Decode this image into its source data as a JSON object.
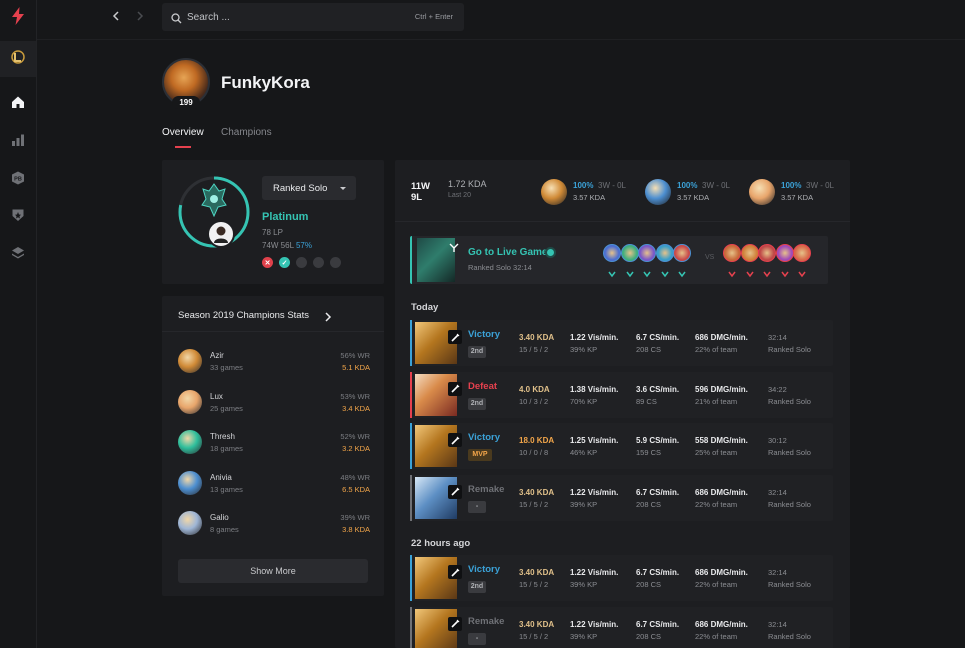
{
  "search": {
    "placeholder": "Search ...",
    "shortcut": "Ctrl + Enter"
  },
  "profile": {
    "name": "FunkyKora",
    "level": "199"
  },
  "tabs": [
    {
      "label": "Overview",
      "active": true
    },
    {
      "label": "Champions",
      "active": false
    }
  ],
  "rank": {
    "queue": "Ranked Solo",
    "tier": "Platinum",
    "lp": "78 LP",
    "record": "74W 56L",
    "winrate": "57%",
    "recent": [
      "loss",
      "win",
      "none",
      "none",
      "none"
    ]
  },
  "season_stats": {
    "title": "Season 2019 Champions Stats",
    "champions": [
      {
        "name": "Azir",
        "games": "33 games",
        "wr": "56% WR",
        "kda": "5.1 KDA",
        "color": "#d08a36"
      },
      {
        "name": "Lux",
        "games": "25 games",
        "wr": "53% WR",
        "kda": "3.4 KDA",
        "color": "#e8a56b"
      },
      {
        "name": "Thresh",
        "games": "18 games",
        "wr": "52% WR",
        "kda": "3.2 KDA",
        "color": "#2fbf9c"
      },
      {
        "name": "Anivia",
        "games": "13 games",
        "wr": "48% WR",
        "kda": "6.5 KDA",
        "color": "#4d8fd1"
      },
      {
        "name": "Galio",
        "games": "8 games",
        "wr": "39% WR",
        "kda": "3.8 KDA",
        "color": "#9fb6d6"
      }
    ],
    "show_more": "Show More"
  },
  "summary": {
    "wins": "11W",
    "losses": "9L",
    "kda": "1.72 KDA",
    "last": "Last 20",
    "champs": [
      {
        "pct": "100%",
        "rec": "3W - 0L",
        "kda": "3.57 KDA",
        "color": "#d08a36"
      },
      {
        "pct": "100%",
        "rec": "3W - 0L",
        "kda": "3.57 KDA",
        "color": "#4d8fd1"
      },
      {
        "pct": "100%",
        "rec": "3W - 0L",
        "kda": "3.57 KDA",
        "color": "#e8a56b"
      }
    ]
  },
  "live": {
    "title": "Go to Live Game",
    "queue": "Ranked Solo",
    "time": "32:14",
    "vs": "VS",
    "team_blue_colors": [
      "#4d6fd1",
      "#3fae7e",
      "#7a58c8",
      "#3a9ec9",
      "#c84a4a"
    ],
    "team_red_colors": [
      "#c86a3a",
      "#d0803a",
      "#c04848",
      "#a04ab8",
      "#d86a4a"
    ]
  },
  "sections": {
    "today": "Today",
    "earlier": "22 hours ago"
  },
  "matches": [
    {
      "result": "Victory",
      "type": "victory",
      "pos": "2nd",
      "kda": "3.40 KDA",
      "kda_type": "normal",
      "kd": "15 / 5 / 2",
      "vis": "1.22 Vis/min.",
      "kp": "39% KP",
      "cs": "6.7 CS/min.",
      "cs_total": "208 CS",
      "dmg": "686 DMG/min.",
      "team": "22% of team",
      "time": "32:14",
      "queue": "Ranked Solo",
      "champ": "azir"
    },
    {
      "result": "Defeat",
      "type": "defeat",
      "pos": "2nd",
      "kda": "4.0 KDA",
      "kda_type": "normal",
      "kd": "10 / 3 / 2",
      "vis": "1.38 Vis/min.",
      "kp": "70% KP",
      "cs": "3.6 CS/min.",
      "cs_total": "89 CS",
      "dmg": "596 DMG/min.",
      "team": "21% of team",
      "time": "34:22",
      "queue": "Ranked Solo",
      "champ": "lux"
    },
    {
      "result": "Victory",
      "type": "victory",
      "pos": "MVP",
      "kda": "18.0 KDA",
      "kda_type": "high",
      "kd": "10 / 0 / 8",
      "vis": "1.25 Vis/min.",
      "kp": "46% KP",
      "cs": "5.9 CS/min.",
      "cs_total": "159 CS",
      "dmg": "558 DMG/min.",
      "team": "25% of team",
      "time": "30:12",
      "queue": "Ranked Solo",
      "champ": "azir"
    },
    {
      "result": "Remake",
      "type": "remake",
      "pos": "-",
      "kda": "3.40 KDA",
      "kda_type": "normal",
      "kd": "15 / 5 / 2",
      "vis": "1.22 Vis/min.",
      "kp": "39% KP",
      "cs": "6.7 CS/min.",
      "cs_total": "208 CS",
      "dmg": "686 DMG/min.",
      "team": "22% of team",
      "time": "32:14",
      "queue": "Ranked Solo",
      "champ": "anivia"
    },
    {
      "result": "Victory",
      "type": "victory",
      "pos": "2nd",
      "kda": "3.40 KDA",
      "kda_type": "normal",
      "kd": "15 / 5 / 2",
      "vis": "1.22 Vis/min.",
      "kp": "39% KP",
      "cs": "6.7 CS/min.",
      "cs_total": "208 CS",
      "dmg": "686 DMG/min.",
      "team": "22% of team",
      "time": "32:14",
      "queue": "Ranked Solo",
      "champ": "azir"
    },
    {
      "result": "Remake",
      "type": "remake",
      "pos": "-",
      "kda": "3.40 KDA",
      "kda_type": "normal",
      "kd": "15 / 5 / 2",
      "vis": "1.22 Vis/min.",
      "kp": "39% KP",
      "cs": "6.7 CS/min.",
      "cs_total": "208 CS",
      "dmg": "686 DMG/min.",
      "team": "22% of team",
      "time": "32:14",
      "queue": "Ranked Solo",
      "champ": "azir"
    }
  ],
  "colors": {
    "accent_red": "#e5414e",
    "teal": "#35c4b3",
    "blue": "#3ba2d8",
    "orange": "#f3a64a",
    "remake_gray": "#6f7176"
  }
}
